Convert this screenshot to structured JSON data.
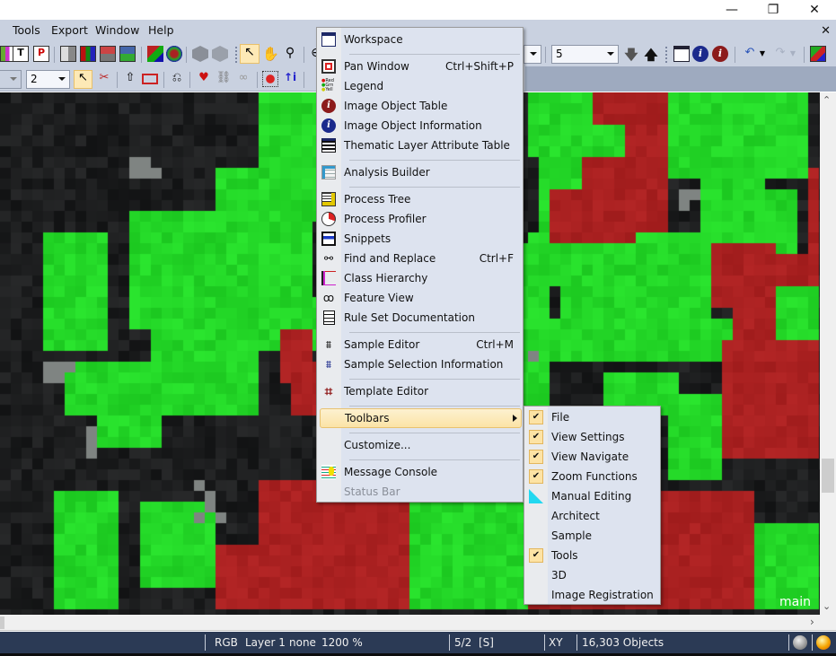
{
  "window": {
    "controls": {
      "minimize": "—",
      "maximize": "❐",
      "close": "✕"
    },
    "mdi_close": "✕"
  },
  "menubar": {
    "items": [
      "Tools",
      "Export",
      "Window",
      "Help"
    ]
  },
  "toolbar": {
    "level_combo_value": "2",
    "right_combo_value": "5"
  },
  "view": {
    "label": "main"
  },
  "statusbar": {
    "color_mode": "RGB",
    "layer": "Layer 1",
    "thematic": "none",
    "zoom": "1200 %",
    "level": "5/2  [S]",
    "coords": "XY",
    "objects": "16,303 Objects"
  },
  "view_menu": {
    "items": [
      {
        "label": "Workspace",
        "shortcut": "",
        "icon": "workspace-icon"
      },
      {
        "label": "Pan Window",
        "shortcut": "Ctrl+Shift+P",
        "icon": "pan-window-icon"
      },
      {
        "label": "Legend",
        "shortcut": "",
        "icon": "legend-icon"
      },
      {
        "label": "Image Object Table",
        "shortcut": "",
        "icon": "image-object-table-icon"
      },
      {
        "label": "Image Object Information",
        "shortcut": "",
        "icon": "info-icon"
      },
      {
        "label": "Thematic Layer Attribute Table",
        "shortcut": "",
        "icon": "table-icon"
      },
      {
        "label": "Analysis Builder",
        "shortcut": "",
        "icon": "analysis-builder-icon"
      },
      {
        "label": "Process Tree",
        "shortcut": "",
        "icon": "process-tree-icon"
      },
      {
        "label": "Process Profiler",
        "shortcut": "",
        "icon": "stopwatch-icon"
      },
      {
        "label": "Snippets",
        "shortcut": "",
        "icon": "snippets-icon"
      },
      {
        "label": "Find and Replace",
        "shortcut": "Ctrl+F",
        "icon": "binoculars-icon"
      },
      {
        "label": "Class Hierarchy",
        "shortcut": "",
        "icon": "class-hierarchy-icon"
      },
      {
        "label": "Feature View",
        "shortcut": "",
        "icon": "glasses-icon"
      },
      {
        "label": "Rule Set Documentation",
        "shortcut": "",
        "icon": "document-icon"
      },
      {
        "label": "Sample Editor",
        "shortcut": "Ctrl+M",
        "icon": "sample-editor-icon"
      },
      {
        "label": "Sample Selection Information",
        "shortcut": "",
        "icon": "sample-selection-icon"
      },
      {
        "label": "Template Editor",
        "shortcut": "",
        "icon": "template-editor-icon"
      },
      {
        "label": "Toolbars",
        "shortcut": "",
        "icon": ""
      },
      {
        "label": "Customize...",
        "shortcut": "",
        "icon": ""
      },
      {
        "label": "Message Console",
        "shortcut": "",
        "icon": "message-console-icon"
      },
      {
        "label": "Status Bar",
        "shortcut": "",
        "icon": ""
      }
    ]
  },
  "toolbars_submenu": {
    "items": [
      {
        "label": "File",
        "checked": true
      },
      {
        "label": "View Settings",
        "checked": true
      },
      {
        "label": "View Navigate",
        "checked": true
      },
      {
        "label": "Zoom Functions",
        "checked": true
      },
      {
        "label": "Manual Editing",
        "checked": false,
        "icon": "set-square-icon"
      },
      {
        "label": "Architect",
        "checked": false
      },
      {
        "label": "Sample",
        "checked": false
      },
      {
        "label": "Tools",
        "checked": true
      },
      {
        "label": "3D",
        "checked": false
      },
      {
        "label": "Image Registration",
        "checked": false
      }
    ],
    "check_glyph": "✔"
  },
  "colors": {
    "class_green": "#26d62a",
    "class_red": "#a82424",
    "statusbar_bg": "#2b3a55",
    "menu_bg": "#dde3ef",
    "highlight": "#fbe3a6"
  }
}
